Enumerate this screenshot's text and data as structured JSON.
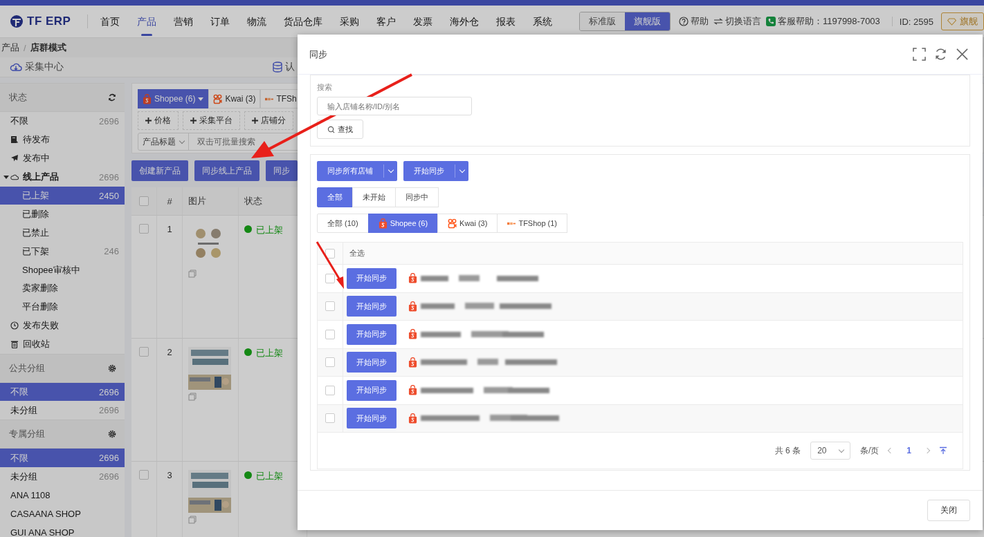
{
  "top_nav": {
    "logo": "TF ERP",
    "items": [
      {
        "label": "首页",
        "selected": false
      },
      {
        "label": "产品",
        "selected": true
      },
      {
        "label": "营销",
        "selected": false
      },
      {
        "label": "订单",
        "selected": false
      },
      {
        "label": "物流",
        "selected": false
      },
      {
        "label": "货品仓库",
        "selected": false
      },
      {
        "label": "采购",
        "selected": false
      },
      {
        "label": "客户",
        "selected": false
      },
      {
        "label": "发票",
        "selected": false
      },
      {
        "label": "海外仓",
        "selected": false
      },
      {
        "label": "报表",
        "selected": false
      },
      {
        "label": "系统",
        "selected": false
      }
    ],
    "editions": [
      {
        "label": "标准版",
        "selected": false
      },
      {
        "label": "旗舰版",
        "selected": true
      }
    ],
    "help": "帮助",
    "language": "切换语言",
    "support": "客服帮助：1197998-7003",
    "account_id": "ID: 2595",
    "upgrade": "旗舰"
  },
  "breadcrumb": {
    "items": [
      "产品",
      "店群模式"
    ],
    "separator": "/"
  },
  "workflow_tabs": [
    {
      "label": "采集中心"
    },
    {
      "label": "认"
    }
  ],
  "sidebar": {
    "sections": [
      {
        "title": "状态",
        "items": [
          {
            "label": "不限",
            "count": "2696",
            "selected": false
          },
          {
            "label": "待发布",
            "selected": false
          },
          {
            "label": "发布中",
            "selected": false
          },
          {
            "label": "线上产品",
            "count": "2696",
            "selected": false,
            "expanded": true,
            "children": [
              {
                "label": "已上架",
                "count": "2450",
                "selected": true
              },
              {
                "label": "已删除",
                "selected": false
              },
              {
                "label": "已禁止",
                "selected": false
              },
              {
                "label": "已下架",
                "count": "246",
                "selected": false
              },
              {
                "label": "Shopee审核中",
                "selected": false
              },
              {
                "label": "卖家删除",
                "selected": false
              },
              {
                "label": "平台删除",
                "selected": false
              }
            ]
          },
          {
            "label": "发布失败",
            "selected": false
          },
          {
            "label": "回收站",
            "selected": false
          }
        ]
      },
      {
        "title": "公共分组",
        "items": [
          {
            "label": "不限",
            "count": "2696",
            "selected": true
          },
          {
            "label": "未分组",
            "count": "2696",
            "selected": false
          }
        ]
      },
      {
        "title": "专属分组",
        "items": [
          {
            "label": "不限",
            "count": "2696",
            "selected": true
          },
          {
            "label": "未分组",
            "count": "2696",
            "selected": false
          },
          {
            "label": "ANA 1108",
            "selected": false
          },
          {
            "label": "CASAANA SHOP",
            "selected": false
          },
          {
            "label": "GUI ANA SHOP",
            "selected": false
          }
        ]
      }
    ]
  },
  "platform_tabs": [
    {
      "label": "Shopee (6)",
      "selected": true
    },
    {
      "label": "Kwai (3)",
      "selected": false
    },
    {
      "label": "TFSh",
      "selected": false
    }
  ],
  "filters": [
    "价格",
    "采集平台",
    "店铺分"
  ],
  "search": {
    "field": "产品标题",
    "placeholder": "双击可批量搜索"
  },
  "actions": [
    "创建新产品",
    "同步线上产品",
    "同步"
  ],
  "product_table": {
    "select_all_checked": false,
    "columns": [
      "#",
      "图片",
      "状态"
    ],
    "rows": [
      {
        "index": "1",
        "checked": false,
        "status": "已上架"
      },
      {
        "index": "2",
        "checked": false,
        "status": "已上架"
      },
      {
        "index": "3",
        "checked": false,
        "status": "已上架"
      }
    ]
  },
  "dialog": {
    "title": "同步",
    "search_label": "搜索",
    "search_placeholder": "输入店铺名称/ID/别名",
    "find_button": "查找",
    "split_buttons": [
      "同步所有店铺",
      "开始同步"
    ],
    "status_filter": [
      {
        "label": "全部",
        "selected": true
      },
      {
        "label": "未开始",
        "selected": false
      },
      {
        "label": "同步中",
        "selected": false
      }
    ],
    "platform_filter": [
      {
        "label": "全部 (10)",
        "selected": false
      },
      {
        "label": "Shopee (6)",
        "selected": true
      },
      {
        "label": "Kwai (3)",
        "selected": false
      },
      {
        "label": "TFShop (1)",
        "selected": false
      }
    ],
    "select_all": {
      "label": "全选",
      "checked": false
    },
    "rows": [
      {
        "checked": false,
        "action": "开始同步"
      },
      {
        "checked": false,
        "action": "开始同步"
      },
      {
        "checked": false,
        "action": "开始同步"
      },
      {
        "checked": false,
        "action": "开始同步"
      },
      {
        "checked": false,
        "action": "开始同步"
      },
      {
        "checked": false,
        "action": "开始同步"
      }
    ],
    "pagination": {
      "total": "共 6 条",
      "page_size": "20",
      "per_page": "条/页",
      "pages": [
        {
          "label": "1",
          "selected": true
        }
      ]
    },
    "close_button": "关闭"
  }
}
